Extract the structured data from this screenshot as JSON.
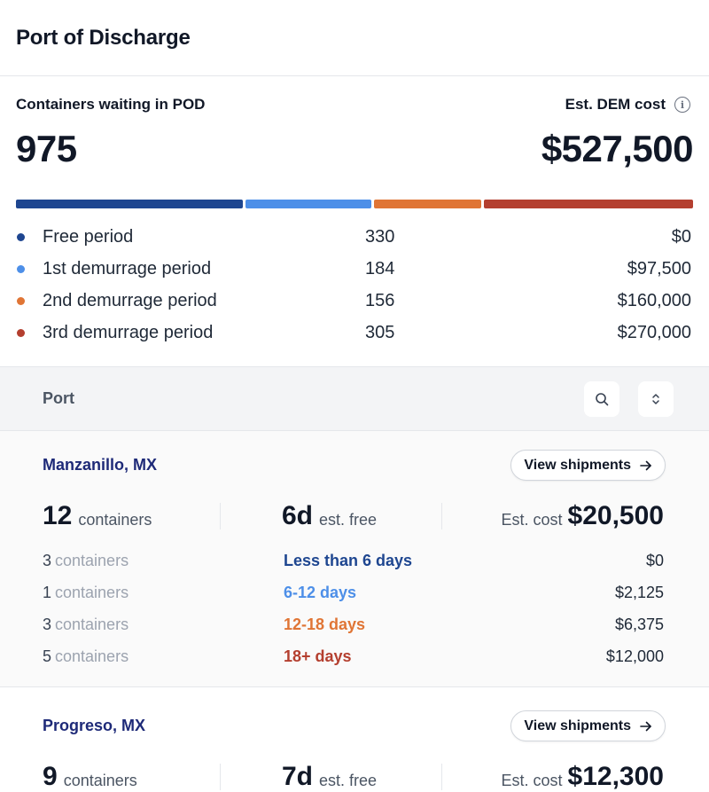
{
  "header": {
    "title": "Port of Discharge"
  },
  "summary": {
    "containers_label": "Containers waiting in POD",
    "containers_value": "975",
    "cost_label": "Est. DEM cost",
    "info_glyph": "i",
    "cost_value": "$527,500",
    "periods": [
      {
        "name": "Free period",
        "count": "330",
        "cost": "$0",
        "color": "#1e4690",
        "share": 330
      },
      {
        "name": "1st demurrage period",
        "count": "184",
        "cost": "$97,500",
        "color": "#4d8fe8",
        "share": 184
      },
      {
        "name": "2nd demurrage period",
        "count": "156",
        "cost": "$160,000",
        "color": "#e07535",
        "share": 156
      },
      {
        "name": "3rd demurrage period",
        "count": "305",
        "cost": "$270,000",
        "color": "#b43f2f",
        "share": 305
      }
    ]
  },
  "table": {
    "column_title": "Port",
    "search_icon": "search-icon",
    "sort_icon": "sort-icon"
  },
  "ports": [
    {
      "name": "Manzanillo, MX",
      "view_label": "View shipments",
      "containers": "12",
      "containers_unit": "containers",
      "free_days": "6d",
      "free_unit": "est. free",
      "cost_label": "Est. cost",
      "cost": "$20,500",
      "breakdown": [
        {
          "count": "3",
          "unit": "containers",
          "range": "Less than 6 days",
          "cost": "$0",
          "color": "#1e4690"
        },
        {
          "count": "1",
          "unit": "containers",
          "range": "6-12 days",
          "cost": "$2,125",
          "color": "#4d8fe8"
        },
        {
          "count": "3",
          "unit": "containers",
          "range": "12-18 days",
          "cost": "$6,375",
          "color": "#e07535"
        },
        {
          "count": "5",
          "unit": "containers",
          "range": "18+ days",
          "cost": "$12,000",
          "color": "#b43f2f"
        }
      ]
    },
    {
      "name": "Progreso, MX",
      "view_label": "View shipments",
      "containers": "9",
      "containers_unit": "containers",
      "free_days": "7d",
      "free_unit": "est. free",
      "cost_label": "Est. cost",
      "cost": "$12,300"
    }
  ]
}
